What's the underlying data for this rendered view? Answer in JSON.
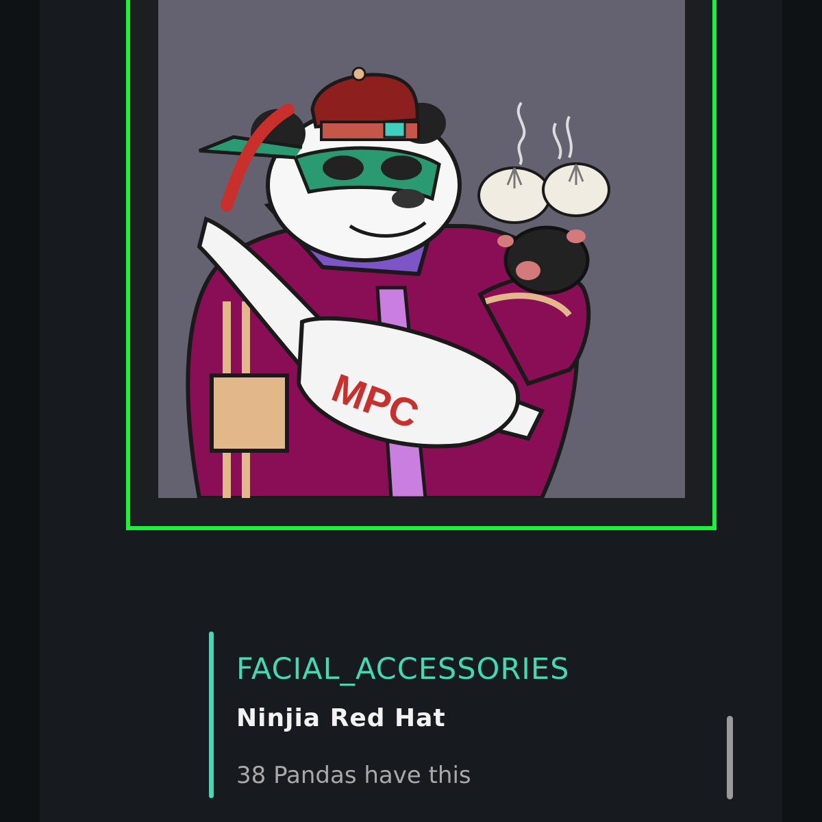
{
  "nft": {
    "image_alt": "Panda NFT wearing a green ninja mask, red cap and MPC belt bag holding steamed buns",
    "bag_text": "MPC",
    "frame_color": "#1cf23c",
    "art_background": "#646270"
  },
  "trait": {
    "type": "FACIAL_ACCESSORIES",
    "value": "Ninjia Red Hat",
    "count_text": "38 Pandas have this",
    "accent_color": "#3fdcb4"
  }
}
